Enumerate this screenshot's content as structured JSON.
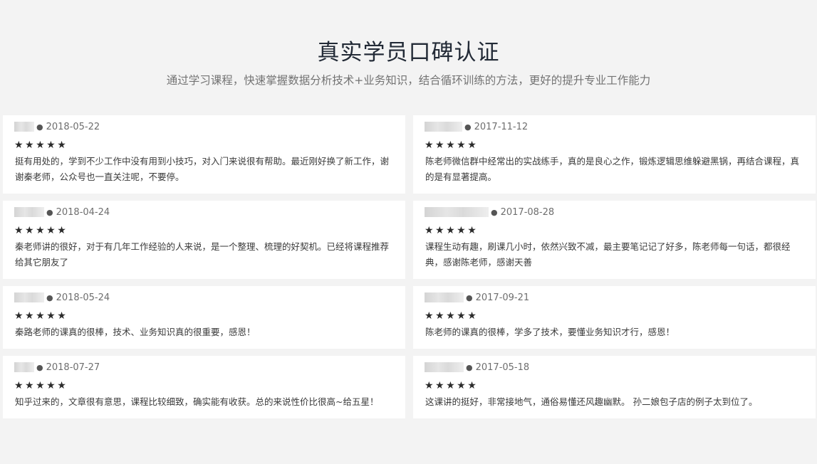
{
  "header": {
    "title": "真实学员口碑认证",
    "subtitle": "通过学习课程，快速掌握数据分析技术+业务知识，结合循环训练的方法，更好的提升专业工作能力"
  },
  "icons": {
    "star": "star-icon"
  },
  "colors": {
    "background": "#f3f3f3",
    "card": "#ffffff",
    "title": "#222a36",
    "text": "#3a3a3a"
  },
  "reviews": [
    {
      "date": "2018-05-22",
      "rating": 5,
      "stars": "★★★★★",
      "text": "挺有用处的，学到不少工作中没有用到小技巧，对入门来说很有帮助。最近刚好换了新工作，谢谢秦老师，公众号也一直关注呢，不要停。"
    },
    {
      "date": "2017-11-12",
      "rating": 5,
      "stars": "★★★★★",
      "text": "陈老师微信群中经常出的实战练手，真的是良心之作，锻炼逻辑思维躲避黑锅，再结合课程，真的是有显著提高。"
    },
    {
      "date": "2018-04-24",
      "rating": 5,
      "stars": "★★★★★",
      "text": "秦老师讲的很好，对于有几年工作经验的人来说，是一个整理、梳理的好契机。已经将课程推荐给其它朋友了"
    },
    {
      "date": "2017-08-28",
      "rating": 5,
      "stars": "★★★★★",
      "text": "课程生动有趣，刷课几小时，依然兴致不减，最主要笔记记了好多，陈老师每一句话，都很经典，感谢陈老师，感谢天善"
    },
    {
      "date": "2018-05-24",
      "rating": 5,
      "stars": "★★★★★",
      "text": "秦路老师的课真的很棒，技术、业务知识真的很重要，感恩！"
    },
    {
      "date": "2017-09-21",
      "rating": 5,
      "stars": "★★★★★",
      "text": "陈老师的课真的很棒，学多了技术，要懂业务知识才行，感恩！"
    },
    {
      "date": "2018-07-27",
      "rating": 5,
      "stars": "★★★★★",
      "text": "知乎过来的，文章很有意思，课程比较细致，确实能有收获。总的来说性价比很高~给五星！"
    },
    {
      "date": "2017-05-18",
      "rating": 5,
      "stars": "★★★★★",
      "text": "这课讲的挺好，非常接地气，通俗易懂还风趣幽默。 孙二娘包子店的例子太到位了。"
    }
  ]
}
